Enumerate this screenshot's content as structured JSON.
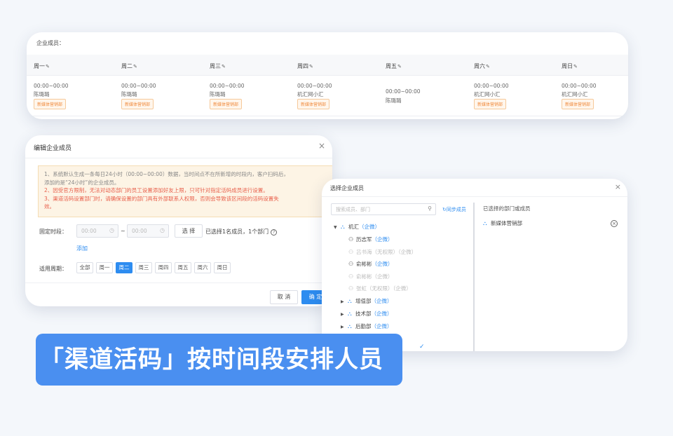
{
  "schedule": {
    "title": "企业成员：",
    "edit_icon": "pencil-icon",
    "days": [
      {
        "label": "周一",
        "time": "00:00~00:00",
        "person": "陈璐璐",
        "tag": "新媒体营销部"
      },
      {
        "label": "周二",
        "time": "00:00~00:00",
        "person": "陈璐璐",
        "tag": "新媒体营销部"
      },
      {
        "label": "周三",
        "time": "00:00~00:00",
        "person": "陈璐璐",
        "tag": "新媒体营销部"
      },
      {
        "label": "周四",
        "time": "00:00~00:00",
        "person": "机汇网小汇",
        "tag": "新媒体营销部"
      },
      {
        "label": "周五",
        "time": "00:00~00:00",
        "person": "陈璐璐",
        "tag": ""
      },
      {
        "label": "周六",
        "time": "00:00~00:00",
        "person": "机汇网小汇",
        "tag": "新媒体营销部"
      },
      {
        "label": "周日",
        "time": "00:00~00:00",
        "person": "机汇网小汇",
        "tag": "新媒体营销部"
      }
    ]
  },
  "edit_dialog": {
    "title": "编辑企业成员",
    "close": "×",
    "notices": [
      "1、系统默认生成一条每日24小时（00:00~00:00）数据，当时间点不在所新增的时段内，客户扫码后，",
      "添加的是“24小时”的企业成员。",
      "2、因受官方限制，无法对动态部门的员工设置添加好友上限，只可针对指定活码成员进行设置。",
      "3、渠道活码设置部门时，请确保设置的部门具有外部联系人权限，否则会导致该区间段的活码设置失",
      "效。"
    ],
    "fixed_period_label": "固定时段：",
    "start_placeholder": "00:00",
    "end_placeholder": "00:00",
    "range_sep": "~",
    "select_label": "选 择",
    "selected_info": "已选择1名成员，1个部门",
    "help_glyph": "?",
    "add_link": "添加",
    "cycle_label": "适用周期：",
    "cycle_days": [
      "全部",
      "周一",
      "周二",
      "周三",
      "周四",
      "周五",
      "周六",
      "周日"
    ],
    "active_day_index": 2,
    "cancel_label": "取 消",
    "ok_label": "确 定"
  },
  "select_dialog": {
    "title": "选择企业成员",
    "close": "×",
    "search_placeholder": "搜索成员、部门",
    "sync_label": "同步成员",
    "tree": [
      {
        "arrow": "▼",
        "type": "org",
        "name": "机汇",
        "tag": "（企微）",
        "dim": false,
        "level": 0
      },
      {
        "arrow": "",
        "type": "person",
        "name": "历志军",
        "tag": "（企微）",
        "dim": false,
        "level": 1
      },
      {
        "arrow": "",
        "type": "person",
        "name": "吕书海（无权限）",
        "tag": "（企微）",
        "dim": true,
        "level": 1
      },
      {
        "arrow": "",
        "type": "person",
        "name": "俞彬彬",
        "tag": "（企微）",
        "dim": false,
        "level": 1
      },
      {
        "arrow": "",
        "type": "person",
        "name": "俞彬彬",
        "tag": "（企微）",
        "dim": true,
        "level": 1
      },
      {
        "arrow": "",
        "type": "person",
        "name": "张虹（无权限）",
        "tag": "（企微）",
        "dim": true,
        "level": 1
      },
      {
        "arrow": "▶",
        "type": "org",
        "name": "增值部",
        "tag": "（企微）",
        "dim": false,
        "level": 1
      },
      {
        "arrow": "▶",
        "type": "org",
        "name": "技术部",
        "tag": "（企微）",
        "dim": false,
        "level": 1
      },
      {
        "arrow": "▶",
        "type": "org",
        "name": "后勤部",
        "tag": "（企微）",
        "dim": false,
        "level": 1
      }
    ],
    "right_title": "已选择的部门或成员",
    "selected_item": "新媒体营销部",
    "remove_glyph": "×",
    "check_glyph": "✓"
  },
  "banner": {
    "text": "「渠道活码」按时间段安排人员"
  },
  "colors": {
    "primary": "#2d8cf0",
    "banner": "#4a8ff0",
    "warning_text": "#e8604c",
    "tag_orange": "#f08a3c"
  }
}
